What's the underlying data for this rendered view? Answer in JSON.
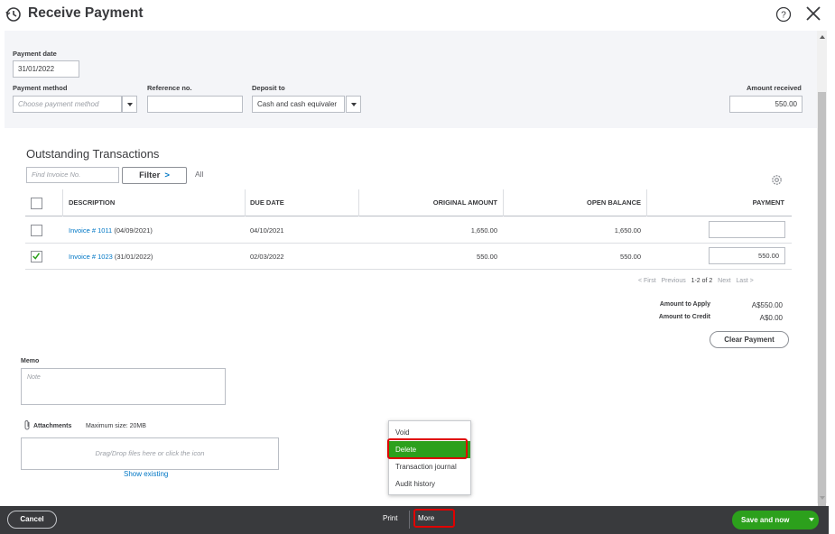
{
  "header": {
    "title": "Receive Payment",
    "icon": "clock-history-icon"
  },
  "form": {
    "payment_date_label": "Payment date",
    "payment_date_value": "31/01/2022",
    "payment_method_label": "Payment method",
    "payment_method_placeholder": "Choose payment method",
    "reference_label": "Reference no.",
    "reference_value": "",
    "deposit_to_label": "Deposit to",
    "deposit_to_value": "Cash and cash equivaler",
    "amount_received_label": "Amount received",
    "amount_received_value": "550.00"
  },
  "outstanding": {
    "title": "Outstanding Transactions",
    "find_placeholder": "Find Invoice No.",
    "filter_label": "Filter",
    "filter_chevron": ">",
    "all_label": "All",
    "columns": [
      "DESCRIPTION",
      "DUE DATE",
      "ORIGINAL AMOUNT",
      "OPEN BALANCE",
      "PAYMENT"
    ],
    "rows": [
      {
        "checked": false,
        "invoice_link": "Invoice # 1011",
        "invoice_date": "(04/09/2021)",
        "due_date": "04/10/2021",
        "original_amount": "1,650.00",
        "open_balance": "1,650.00",
        "payment": ""
      },
      {
        "checked": true,
        "invoice_link": "Invoice # 1023",
        "invoice_date": "(31/01/2022)",
        "due_date": "02/03/2022",
        "original_amount": "550.00",
        "open_balance": "550.00",
        "payment": "550.00"
      }
    ],
    "pager": {
      "first": "< First",
      "previous": "Previous",
      "range": "1-2 of 2",
      "next": "Next",
      "last": "Last >"
    }
  },
  "summary": {
    "amount_to_apply_label": "Amount to Apply",
    "amount_to_apply_value": "A$550.00",
    "amount_to_credit_label": "Amount to Credit",
    "amount_to_credit_value": "A$0.00",
    "clear_payment_label": "Clear Payment"
  },
  "memo": {
    "label": "Memo",
    "placeholder": "Note"
  },
  "attachments": {
    "label": "Attachments",
    "max_size": "Maximum size: 20MB",
    "drop_text": "Drag/Drop files here or click the icon",
    "show_existing": "Show existing"
  },
  "more_menu": {
    "items": [
      "Void",
      "Delete",
      "Transaction journal",
      "Audit history"
    ],
    "active_item": "Delete"
  },
  "footer": {
    "cancel_label": "Cancel",
    "print_label": "Print",
    "more_label": "More",
    "save_label": "Save and now"
  },
  "colors": {
    "accent_green": "#2ca01c",
    "link_blue": "#0077c5",
    "footer_bg": "#393a3d",
    "highlight_red": "#e00000"
  }
}
